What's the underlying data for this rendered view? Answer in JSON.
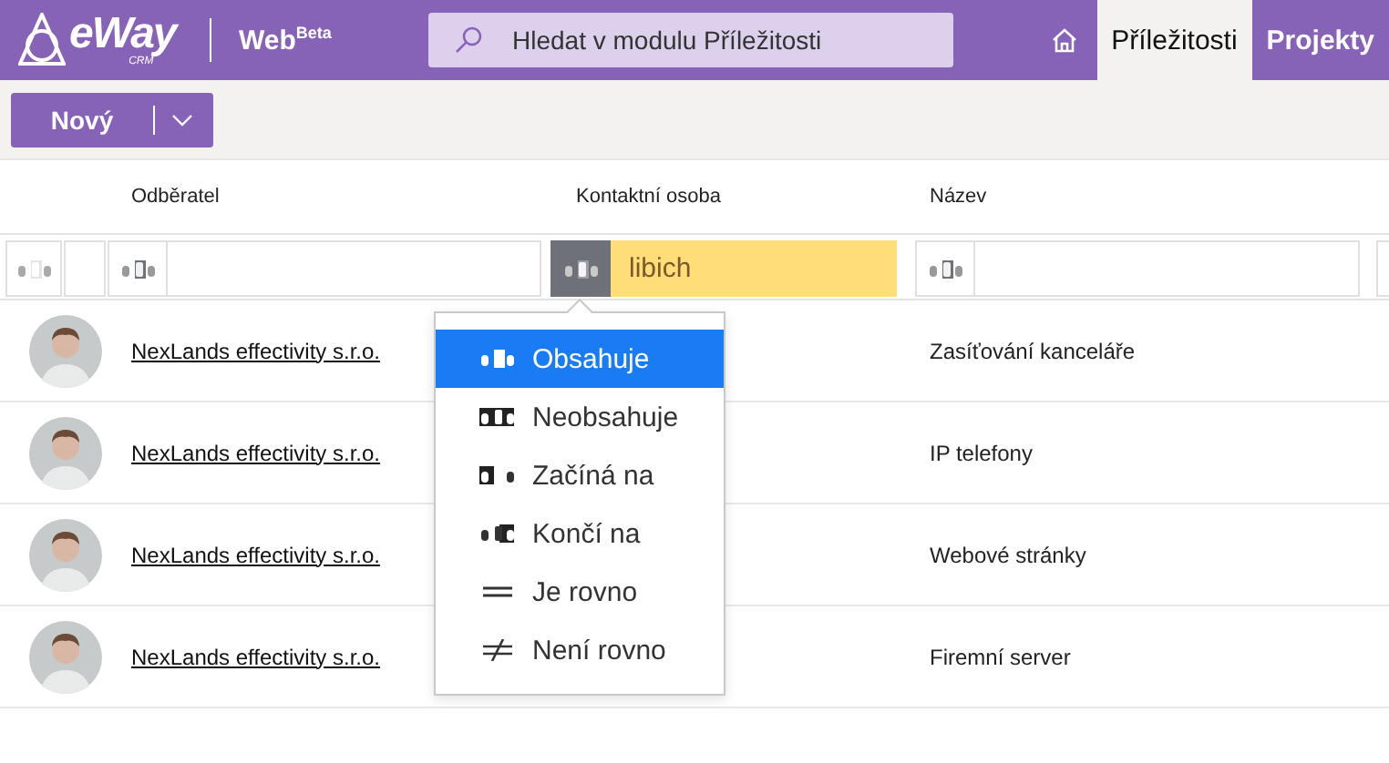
{
  "header": {
    "logo": {
      "name": "eWay",
      "sub": "CRM"
    },
    "product": {
      "name": "Web",
      "tag": "Beta"
    },
    "search": {
      "placeholder": "Hledat v modulu Příležitosti"
    },
    "tabs": [
      {
        "label": "Příležitosti",
        "selected": true
      },
      {
        "label": "Projekty",
        "selected": false
      }
    ]
  },
  "toolbar": {
    "new_button": "Nový"
  },
  "table": {
    "columns": [
      {
        "label": "Odběratel"
      },
      {
        "label": "Kontaktní osoba"
      },
      {
        "label": "Název"
      }
    ],
    "filters": [
      {
        "active": false
      },
      {
        "active": true,
        "value": "libich"
      },
      {
        "active": false
      }
    ],
    "rows": [
      {
        "customer": "NexLands effectivity s.r.o.",
        "name": "Zasíťování kanceláře"
      },
      {
        "customer": "NexLands effectivity s.r.o.",
        "name": "IP telefony"
      },
      {
        "customer": "NexLands effectivity s.r.o.",
        "name": "Webové stránky"
      },
      {
        "customer": "NexLands effectivity s.r.o.",
        "name": "Firemní server"
      }
    ]
  },
  "filter_menu": {
    "items": [
      {
        "label": "Obsahuje",
        "kind": "contains",
        "selected": true
      },
      {
        "label": "Neobsahuje",
        "kind": "not-contains",
        "selected": false
      },
      {
        "label": "Začíná na",
        "kind": "starts",
        "selected": false
      },
      {
        "label": "Končí na",
        "kind": "ends",
        "selected": false
      },
      {
        "label": "Je rovno",
        "kind": "equals",
        "selected": false
      },
      {
        "label": "Není rovno",
        "kind": "not-equals",
        "selected": false
      }
    ]
  }
}
